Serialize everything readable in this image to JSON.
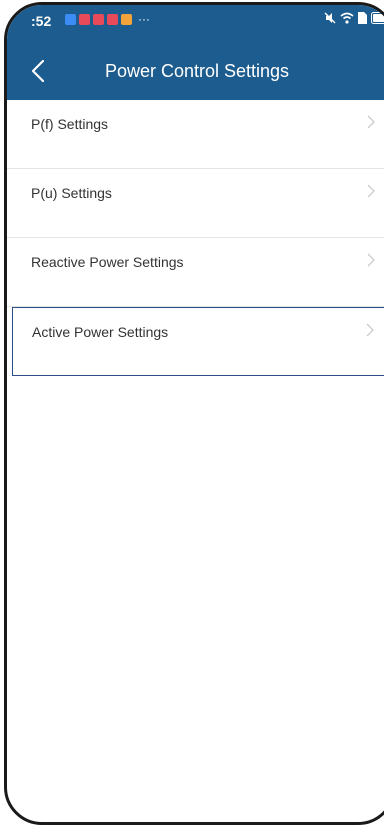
{
  "status_bar": {
    "time": ":52",
    "more": "···"
  },
  "header": {
    "title": "Power Control Settings"
  },
  "list": {
    "items": [
      {
        "label": "P(f) Settings",
        "selected": false
      },
      {
        "label": "P(u) Settings",
        "selected": false
      },
      {
        "label": "Reactive Power Settings",
        "selected": false
      },
      {
        "label": "Active Power Settings",
        "selected": true
      }
    ]
  },
  "icons": {
    "back": "chevron-left-icon",
    "item_arrow": "chevron-right-icon",
    "status": [
      "mute-icon",
      "wifi-icon",
      "sim-icon",
      "battery-icon"
    ]
  },
  "colors": {
    "header": "#1d5c8e",
    "selected_border": "#2b4f86",
    "chevron": "#cccccc",
    "text": "#333333"
  }
}
